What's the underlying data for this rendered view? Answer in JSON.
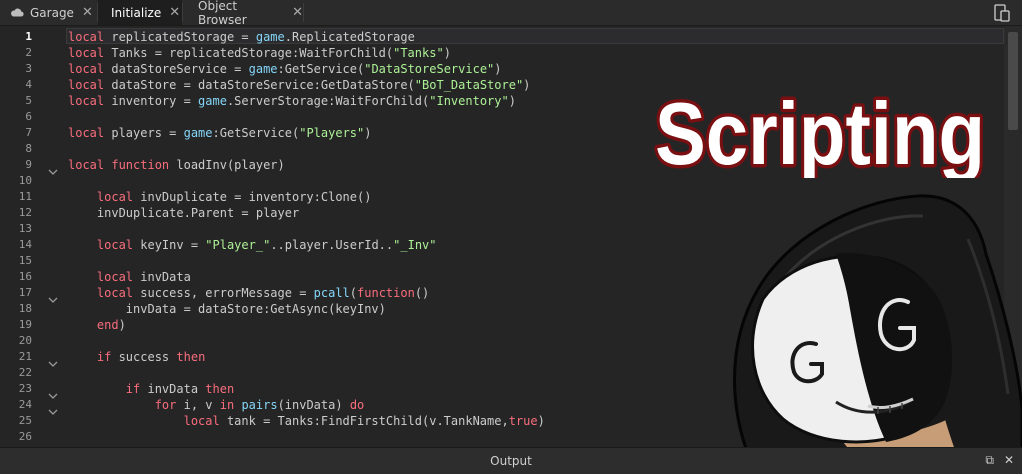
{
  "tabs": [
    {
      "label": "Garage",
      "icon": "cloud-icon",
      "active": false
    },
    {
      "label": "Initialize",
      "active": true
    },
    {
      "label": "Object Browser",
      "active": false
    }
  ],
  "overlay": {
    "title_text": "Scripting"
  },
  "output": {
    "title": "Output"
  },
  "colors": {
    "keyword": "#f86d7c",
    "builtin": "#84d6f7",
    "string": "#adf195",
    "text": "#cccccc",
    "background": "#252526"
  },
  "editor": {
    "current_line": 1,
    "fold_lines": [
      9,
      17,
      21,
      23,
      24
    ],
    "lines": [
      {
        "n": "1",
        "tokens": [
          [
            "kw",
            "local"
          ],
          [
            "id",
            " replicatedStorage = "
          ],
          [
            "bi",
            "game"
          ],
          [
            "id",
            ".ReplicatedStorage"
          ]
        ]
      },
      {
        "n": "2",
        "tokens": [
          [
            "kw",
            "local"
          ],
          [
            "id",
            " Tanks = replicatedStorage:WaitForChild("
          ],
          [
            "str",
            "\"Tanks\""
          ],
          [
            "id",
            ")"
          ]
        ]
      },
      {
        "n": "3",
        "tokens": [
          [
            "kw",
            "local"
          ],
          [
            "id",
            " dataStoreService = "
          ],
          [
            "bi",
            "game"
          ],
          [
            "id",
            ":GetService("
          ],
          [
            "str",
            "\"DataStoreService\""
          ],
          [
            "id",
            ")"
          ]
        ]
      },
      {
        "n": "4",
        "tokens": [
          [
            "kw",
            "local"
          ],
          [
            "id",
            " dataStore = dataStoreService:GetDataStore("
          ],
          [
            "str",
            "\"BoT_DataStore\""
          ],
          [
            "id",
            ")"
          ]
        ]
      },
      {
        "n": "5",
        "tokens": [
          [
            "kw",
            "local"
          ],
          [
            "id",
            " inventory = "
          ],
          [
            "bi",
            "game"
          ],
          [
            "id",
            ".ServerStorage:WaitForChild("
          ],
          [
            "str",
            "\"Inventory\""
          ],
          [
            "id",
            ")"
          ]
        ]
      },
      {
        "n": "6",
        "tokens": []
      },
      {
        "n": "7",
        "tokens": [
          [
            "kw",
            "local"
          ],
          [
            "id",
            " players = "
          ],
          [
            "bi",
            "game"
          ],
          [
            "id",
            ":GetService("
          ],
          [
            "str",
            "\"Players\""
          ],
          [
            "id",
            ")"
          ]
        ]
      },
      {
        "n": "8",
        "tokens": []
      },
      {
        "n": "9",
        "tokens": [
          [
            "kw",
            "local"
          ],
          [
            "id",
            " "
          ],
          [
            "kw",
            "function"
          ],
          [
            "id",
            " loadInv(player)"
          ]
        ]
      },
      {
        "n": "10",
        "tokens": []
      },
      {
        "n": "11",
        "tokens": [
          [
            "id",
            "    "
          ],
          [
            "kw",
            "local"
          ],
          [
            "id",
            " invDuplicate = inventory:Clone()"
          ]
        ]
      },
      {
        "n": "12",
        "tokens": [
          [
            "id",
            "    invDuplicate.Parent = player"
          ]
        ]
      },
      {
        "n": "13",
        "tokens": []
      },
      {
        "n": "14",
        "tokens": [
          [
            "id",
            "    "
          ],
          [
            "kw",
            "local"
          ],
          [
            "id",
            " keyInv = "
          ],
          [
            "str",
            "\"Player_\""
          ],
          [
            "id",
            "..player.UserId.."
          ],
          [
            "str",
            "\"_Inv\""
          ]
        ]
      },
      {
        "n": "15",
        "tokens": []
      },
      {
        "n": "16",
        "tokens": [
          [
            "id",
            "    "
          ],
          [
            "kw",
            "local"
          ],
          [
            "id",
            " invData"
          ]
        ]
      },
      {
        "n": "17",
        "tokens": [
          [
            "id",
            "    "
          ],
          [
            "kw",
            "local"
          ],
          [
            "id",
            " success, errorMessage = "
          ],
          [
            "bi",
            "pcall"
          ],
          [
            "id",
            "("
          ],
          [
            "kw",
            "function"
          ],
          [
            "id",
            "()"
          ]
        ]
      },
      {
        "n": "18",
        "tokens": [
          [
            "id",
            "        invData = dataStore:GetAsync(keyInv)"
          ]
        ]
      },
      {
        "n": "19",
        "tokens": [
          [
            "id",
            "    "
          ],
          [
            "kw",
            "end"
          ],
          [
            "id",
            ")"
          ]
        ]
      },
      {
        "n": "20",
        "tokens": []
      },
      {
        "n": "21",
        "tokens": [
          [
            "id",
            "    "
          ],
          [
            "kw",
            "if"
          ],
          [
            "id",
            " success "
          ],
          [
            "kw",
            "then"
          ]
        ]
      },
      {
        "n": "22",
        "tokens": []
      },
      {
        "n": "23",
        "tokens": [
          [
            "id",
            "        "
          ],
          [
            "kw",
            "if"
          ],
          [
            "id",
            " invData "
          ],
          [
            "kw",
            "then"
          ]
        ]
      },
      {
        "n": "24",
        "tokens": [
          [
            "id",
            "            "
          ],
          [
            "kw",
            "for"
          ],
          [
            "id",
            " i, v "
          ],
          [
            "kw",
            "in"
          ],
          [
            "id",
            " "
          ],
          [
            "bi",
            "pairs"
          ],
          [
            "id",
            "(invData) "
          ],
          [
            "kw",
            "do"
          ]
        ]
      },
      {
        "n": "25",
        "tokens": [
          [
            "id",
            "                "
          ],
          [
            "kw",
            "local"
          ],
          [
            "id",
            " tank = Tanks:FindFirstChild(v.TankName,"
          ],
          [
            "kw",
            "true"
          ],
          [
            "id",
            ")"
          ]
        ]
      },
      {
        "n": "26",
        "tokens": []
      }
    ]
  }
}
